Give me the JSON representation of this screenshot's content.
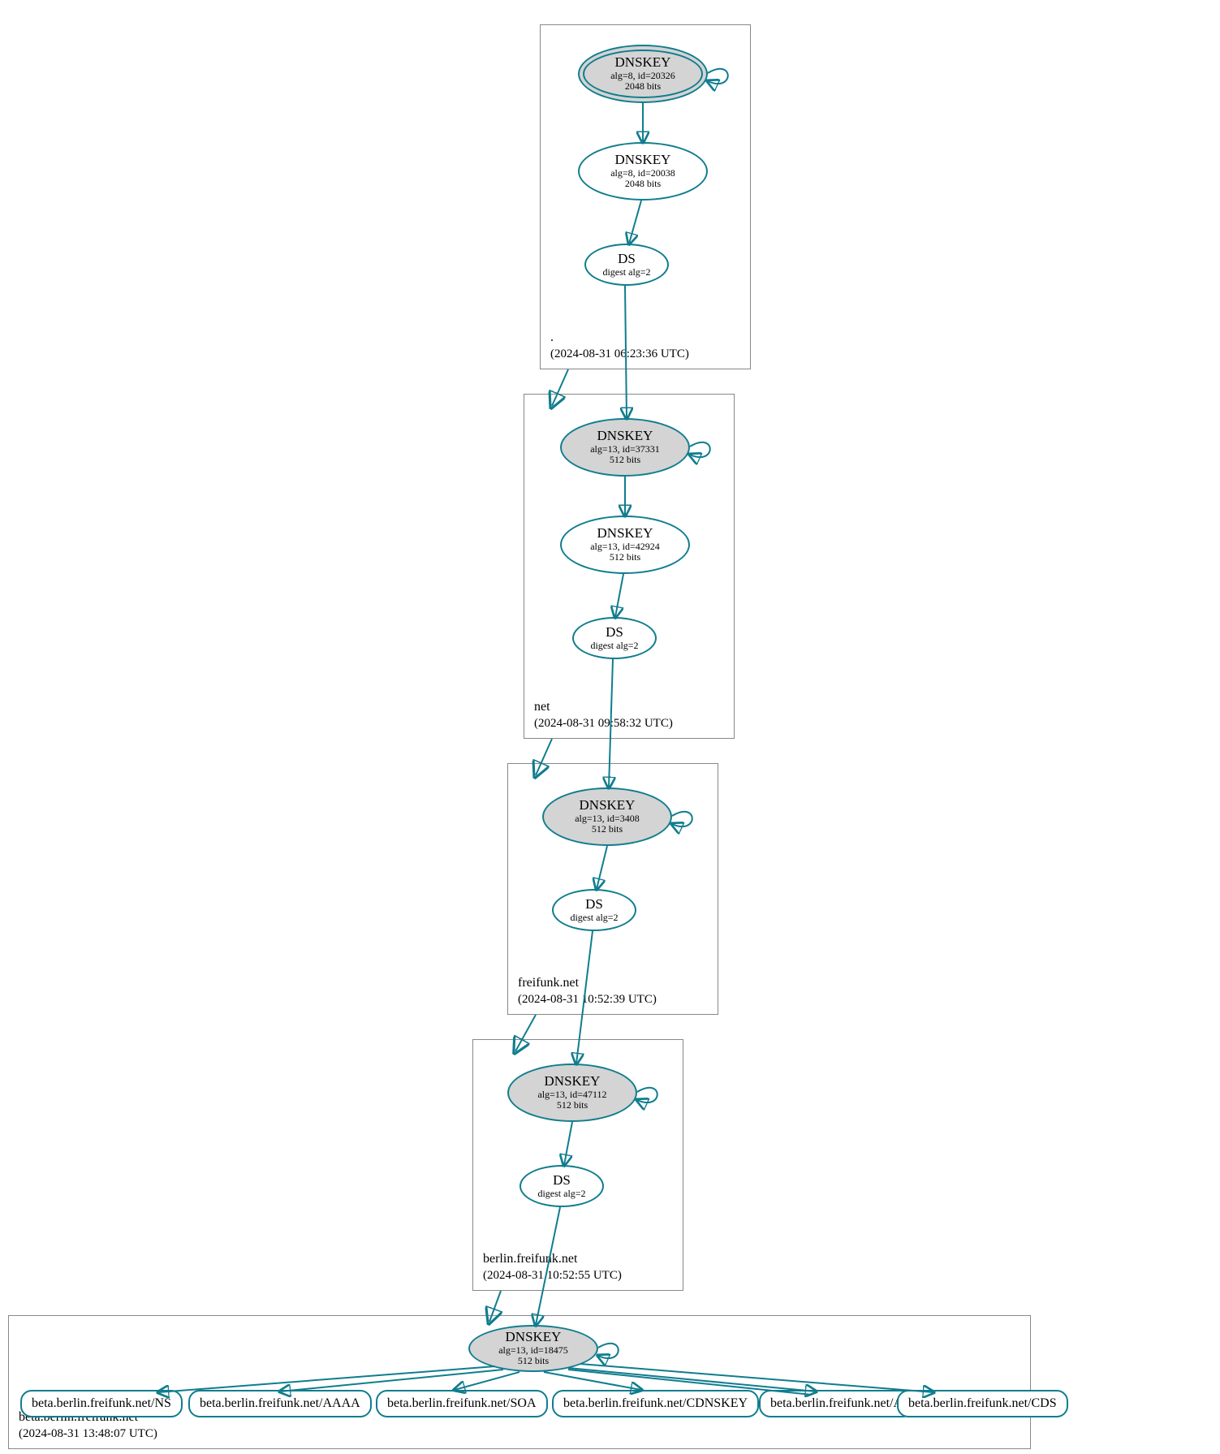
{
  "zones": {
    "root": {
      "name": ".",
      "ts": "(2024-08-31 06:23:36 UTC)"
    },
    "net": {
      "name": "net",
      "ts": "(2024-08-31 09:58:32 UTC)"
    },
    "ff": {
      "name": "freifunk.net",
      "ts": "(2024-08-31 10:52:39 UTC)"
    },
    "bff": {
      "name": "berlin.freifunk.net",
      "ts": "(2024-08-31 10:52:55 UTC)"
    },
    "bbff": {
      "name": "beta.berlin.freifunk.net",
      "ts": "(2024-08-31 13:48:07 UTC)"
    }
  },
  "nodes": {
    "root_ksk": {
      "t": "DNSKEY",
      "s1": "alg=8, id=20326",
      "s2": "2048 bits"
    },
    "root_zsk": {
      "t": "DNSKEY",
      "s1": "alg=8, id=20038",
      "s2": "2048 bits"
    },
    "root_ds": {
      "t": "DS",
      "s1": "digest alg=2"
    },
    "net_ksk": {
      "t": "DNSKEY",
      "s1": "alg=13, id=37331",
      "s2": "512 bits"
    },
    "net_zsk": {
      "t": "DNSKEY",
      "s1": "alg=13, id=42924",
      "s2": "512 bits"
    },
    "net_ds": {
      "t": "DS",
      "s1": "digest alg=2"
    },
    "ff_ksk": {
      "t": "DNSKEY",
      "s1": "alg=13, id=3408",
      "s2": "512 bits"
    },
    "ff_ds": {
      "t": "DS",
      "s1": "digest alg=2"
    },
    "bff_ksk": {
      "t": "DNSKEY",
      "s1": "alg=13, id=47112",
      "s2": "512 bits"
    },
    "bff_ds": {
      "t": "DS",
      "s1": "digest alg=2"
    },
    "bbff_ksk": {
      "t": "DNSKEY",
      "s1": "alg=13, id=18475",
      "s2": "512 bits"
    },
    "leaves": {
      "ns": "beta.berlin.freifunk.net/NS",
      "aaaa": "beta.berlin.freifunk.net/AAAA",
      "soa": "beta.berlin.freifunk.net/SOA",
      "cdk": "beta.berlin.freifunk.net/CDNSKEY",
      "a": "beta.berlin.freifunk.net/A",
      "cds": "beta.berlin.freifunk.net/CDS"
    }
  },
  "colors": {
    "edge": "#107d8e",
    "fill": "#d4d4d4"
  }
}
